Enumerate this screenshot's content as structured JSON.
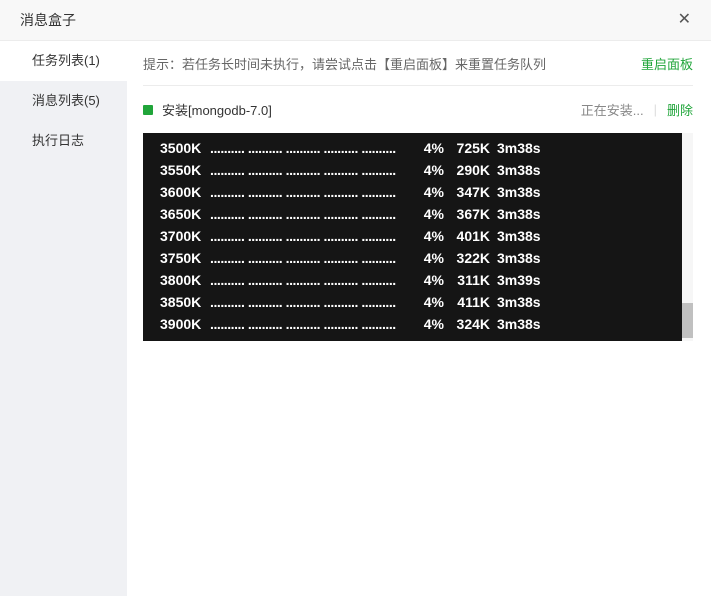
{
  "window": {
    "title": "消息盒子",
    "close_icon": "✕"
  },
  "sidebar": {
    "items": [
      {
        "key": "tasks",
        "label": "任务列表(1)",
        "active": true
      },
      {
        "key": "messages",
        "label": "消息列表(5)",
        "active": false
      },
      {
        "key": "logs",
        "label": "执行日志",
        "active": false
      }
    ]
  },
  "tip": {
    "text": "提示：若任务长时间未执行，请尝试点击【重启面板】来重置任务队列",
    "restart_label": "重启面板"
  },
  "task": {
    "name": "安装[mongodb-7.0]",
    "status": "正在安装...",
    "separator": "|",
    "delete_label": "删除"
  },
  "terminal": {
    "dots": ".......... .......... .......... .......... ..........",
    "lines": [
      {
        "kb": "3500K",
        "pct": "4%",
        "speed": "725K",
        "eta": "3m38s"
      },
      {
        "kb": "3550K",
        "pct": "4%",
        "speed": "290K",
        "eta": "3m38s"
      },
      {
        "kb": "3600K",
        "pct": "4%",
        "speed": "347K",
        "eta": "3m38s"
      },
      {
        "kb": "3650K",
        "pct": "4%",
        "speed": "367K",
        "eta": "3m38s"
      },
      {
        "kb": "3700K",
        "pct": "4%",
        "speed": "401K",
        "eta": "3m38s"
      },
      {
        "kb": "3750K",
        "pct": "4%",
        "speed": "322K",
        "eta": "3m38s"
      },
      {
        "kb": "3800K",
        "pct": "4%",
        "speed": "311K",
        "eta": "3m39s"
      },
      {
        "kb": "3850K",
        "pct": "4%",
        "speed": "411K",
        "eta": "3m38s"
      },
      {
        "kb": "3900K",
        "pct": "4%",
        "speed": "324K",
        "eta": "3m38s"
      }
    ]
  },
  "colors": {
    "accent_green": "#20a53a",
    "terminal_bg": "#151515",
    "sidebar_bg": "#f0f1f4",
    "header_bg": "#f8f8f8"
  }
}
